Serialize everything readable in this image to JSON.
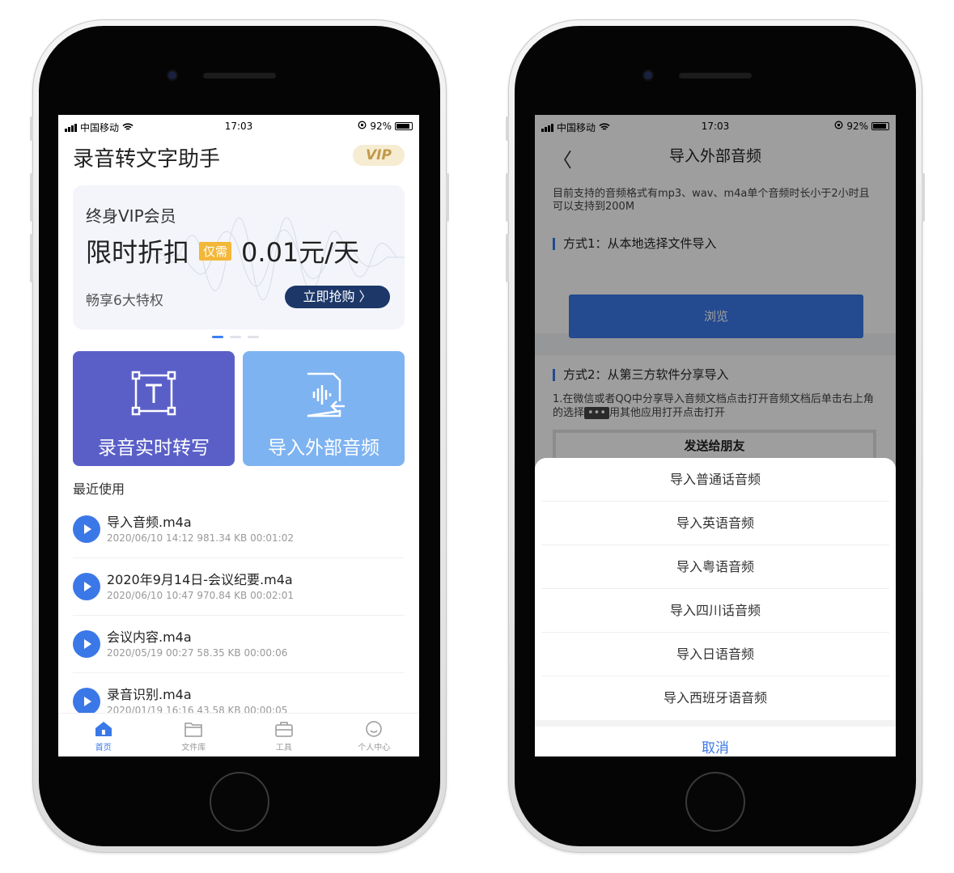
{
  "status": {
    "carrier": "中国移动",
    "time": "17:03",
    "battery": "92%"
  },
  "home": {
    "title": "录音转文字助手",
    "vip_badge": "VIP",
    "banner": {
      "line1": "终身VIP会员",
      "headline": "限时折扣",
      "tag": "仅需",
      "price": "0.01元/天",
      "perks": "畅享6大特权",
      "buy": "立即抢购 〉"
    },
    "tiles": [
      {
        "label": "录音实时转写"
      },
      {
        "label": "导入外部音频"
      }
    ],
    "recent_title": "最近使用",
    "recent": [
      {
        "name": "导入音频.m4a",
        "meta": "2020/06/10 14:12  981.34 KB  00:01:02"
      },
      {
        "name": "2020年9月14日-会议纪要.m4a",
        "meta": "2020/06/10 10:47  970.84 KB  00:02:01"
      },
      {
        "name": "会议内容.m4a",
        "meta": "2020/05/19 00:27  58.35 KB  00:00:06"
      },
      {
        "name": "录音识别.m4a",
        "meta": "2020/01/19 16:16  43.58 KB  00:00:05"
      }
    ],
    "tabs": [
      {
        "label": "首页",
        "icon": "home-icon"
      },
      {
        "label": "文件库",
        "icon": "folder-icon"
      },
      {
        "label": "工具",
        "icon": "briefcase-icon"
      },
      {
        "label": "个人中心",
        "icon": "smile-icon"
      }
    ]
  },
  "import": {
    "title": "导入外部音频",
    "back": "〈",
    "desc": "目前支持的音频格式有mp3、wav、m4a单个音频时长小于2小时且可以支持到200M",
    "method1": "方式1：从本地选择文件导入",
    "browse": "浏览",
    "method2": "方式2：从第三方软件分享导入",
    "method2_text_a": "1.在微信或者QQ中分享导入音频文档点击打开音频文档后单击右上角的选择",
    "method2_kbd": "•••",
    "method2_text_b": "用其他应用打开点击打开",
    "send_friend": "发送给朋友",
    "sheet": [
      "导入普通话音频",
      "导入英语音频",
      "导入粤语音频",
      "导入四川话音频",
      "导入日语音频",
      "导入西班牙语音频"
    ],
    "cancel": "取消"
  },
  "colors": {
    "accent": "#3b78e7",
    "tile1": "#5a5fc8",
    "tile2": "#7eb3f1",
    "buy": "#1c3768"
  }
}
